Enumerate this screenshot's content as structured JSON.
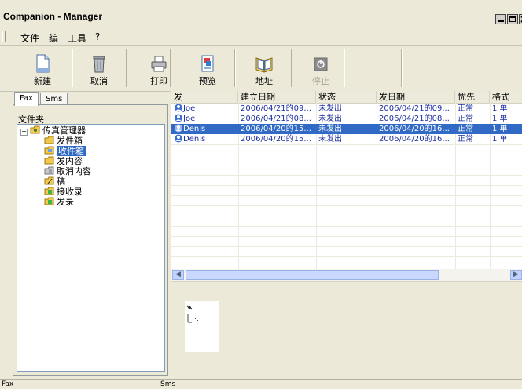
{
  "window": {
    "title": "Companion - Manager"
  },
  "menu": [
    "文件",
    "编",
    "工具",
    "?"
  ],
  "toolbar": {
    "buttons": [
      {
        "label": "新建",
        "icon": "new-document-icon",
        "enabled": true
      },
      {
        "label": "取消",
        "icon": "trash-can-icon",
        "enabled": true
      },
      {
        "label": "打印",
        "icon": "printer-icon",
        "enabled": true
      },
      {
        "label": "预览",
        "icon": "preview-icon",
        "enabled": true
      },
      {
        "label": "地址",
        "icon": "address-book-icon",
        "enabled": true
      },
      {
        "label": "停止",
        "icon": "stop-icon",
        "enabled": false
      }
    ]
  },
  "left_pane": {
    "tabs": [
      "Fax",
      "Sms"
    ],
    "active_tab": "Fax",
    "folders_label": "文件夹",
    "tree": {
      "root": "传真管理器",
      "children": [
        "发件箱",
        "收件箱",
        "发内容",
        "取消内容",
        "稿",
        "接收录",
        "发录"
      ],
      "selected": "收件箱"
    }
  },
  "message_list": {
    "columns": [
      "发",
      "建立日期",
      "状态",
      "发日期",
      "忧先",
      "格式"
    ],
    "rows": [
      {
        "sender": "Joe",
        "created": "2006/04/21的09...",
        "status": "未发出",
        "sent": "2006/04/21的09...",
        "priority": "正常",
        "format": "1 单"
      },
      {
        "sender": "Joe",
        "created": "2006/04/21的08...",
        "status": "未发出",
        "sent": "2006/04/21的08...",
        "priority": "正常",
        "format": "1 单"
      },
      {
        "sender": "Denis",
        "created": "2006/04/20的15...",
        "status": "未发出",
        "sent": "2006/04/20的16...",
        "priority": "正常",
        "format": "1 单"
      },
      {
        "sender": "Denis",
        "created": "2006/04/20的15...",
        "status": "未发出",
        "sent": "2006/04/20的16...",
        "priority": "正常",
        "format": "1 单"
      }
    ],
    "selected_row": 2
  },
  "status_bar": {
    "left": "Fax",
    "right": "Sms"
  },
  "colors": {
    "selection": "#316ac5",
    "row_text": "#1c2f9f",
    "background": "#ece9d8"
  }
}
